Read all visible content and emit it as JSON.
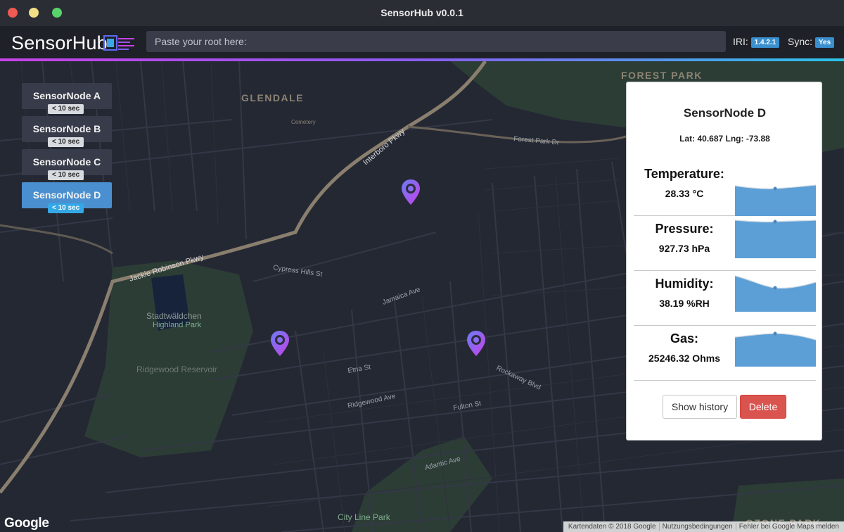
{
  "window": {
    "title": "SensorHub v0.0.1"
  },
  "header": {
    "logo_text": "SensorHub",
    "root_placeholder": "Paste your root here:",
    "iri_label": "IRI:",
    "iri_version": "1.4.2.1",
    "sync_label": "Sync:",
    "sync_value": "Yes"
  },
  "nodes": [
    {
      "name": "SensorNode A",
      "age": "< 10 sec"
    },
    {
      "name": "SensorNode B",
      "age": "< 10 sec"
    },
    {
      "name": "SensorNode C",
      "age": "< 10 sec"
    },
    {
      "name": "SensorNode D",
      "age": "< 10 sec"
    }
  ],
  "detail": {
    "title": "SensorNode D",
    "coords": "Lat: 40.687 Lng: -73.88",
    "metrics": [
      {
        "label": "Temperature:",
        "value": "28.33 °C"
      },
      {
        "label": "Pressure:",
        "value": "927.73 hPa"
      },
      {
        "label": "Humidity:",
        "value": "38.19 %RH"
      },
      {
        "label": "Gas:",
        "value": "25246.32 Ohms"
      }
    ],
    "history_button": "Show history",
    "delete_button": "Delete"
  },
  "map": {
    "labels": {
      "glendale": "GLENDALE",
      "forest_park": "FOREST PARK",
      "ozone_park": "OZONE PARK",
      "interboro": "Interboro Pkwy",
      "jackie": "Jackie Robinson Pkwy",
      "forest_park_dr": "Forest Park Dr",
      "jamaica_ave": "Jamaica Ave",
      "atlantic_ave": "Atlantic Ave",
      "fulton_st": "Fulton St",
      "ridgewood_ave": "Ridgewood Ave",
      "rockaway_blvd": "Rockaway Blvd",
      "etna_st": "Etna St",
      "city_line_park": "City Line Park",
      "stadtwaldchen": "Stadtwäldchen",
      "highland_park": "Highland Park",
      "ridgewood_reservoir": "Ridgewood Reservoir",
      "cypress_hills": "Cypress Hills St",
      "cemetery": "Cemetery"
    }
  },
  "footer": {
    "google": "Google",
    "attribution": [
      "Kartendaten © 2018 Google",
      "Nutzungsbedingungen",
      "Fehler bei Google Maps melden"
    ]
  },
  "colors": {
    "accent": "#4a90d0",
    "badge": "#3a8fce",
    "delete": "#d9534f",
    "pin_gradient_start": "#c742e8",
    "pin_gradient_end": "#6a7cf5",
    "chart_fill": "#5b9fd6"
  }
}
